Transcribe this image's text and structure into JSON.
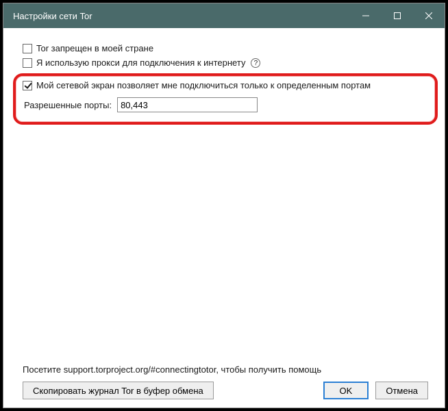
{
  "window": {
    "title": "Настройки сети Tor"
  },
  "options": {
    "censored": {
      "label": "Tor запрещен в моей стране",
      "checked": false
    },
    "proxy": {
      "label": "Я использую прокси для подключения к интернету",
      "help": "?",
      "checked": false
    },
    "firewall": {
      "label": "Мой сетевой экран позволяет мне подключиться только к определенным портам",
      "checked": true,
      "ports_label": "Разрешенные порты:",
      "ports_value": "80,443"
    }
  },
  "footer": {
    "help_text": "Посетите support.torproject.org/#connectingtotor, чтобы получить помощь",
    "copy_log": "Скопировать журнал Tor в буфер обмена",
    "ok": "OK",
    "cancel": "Отмена"
  }
}
